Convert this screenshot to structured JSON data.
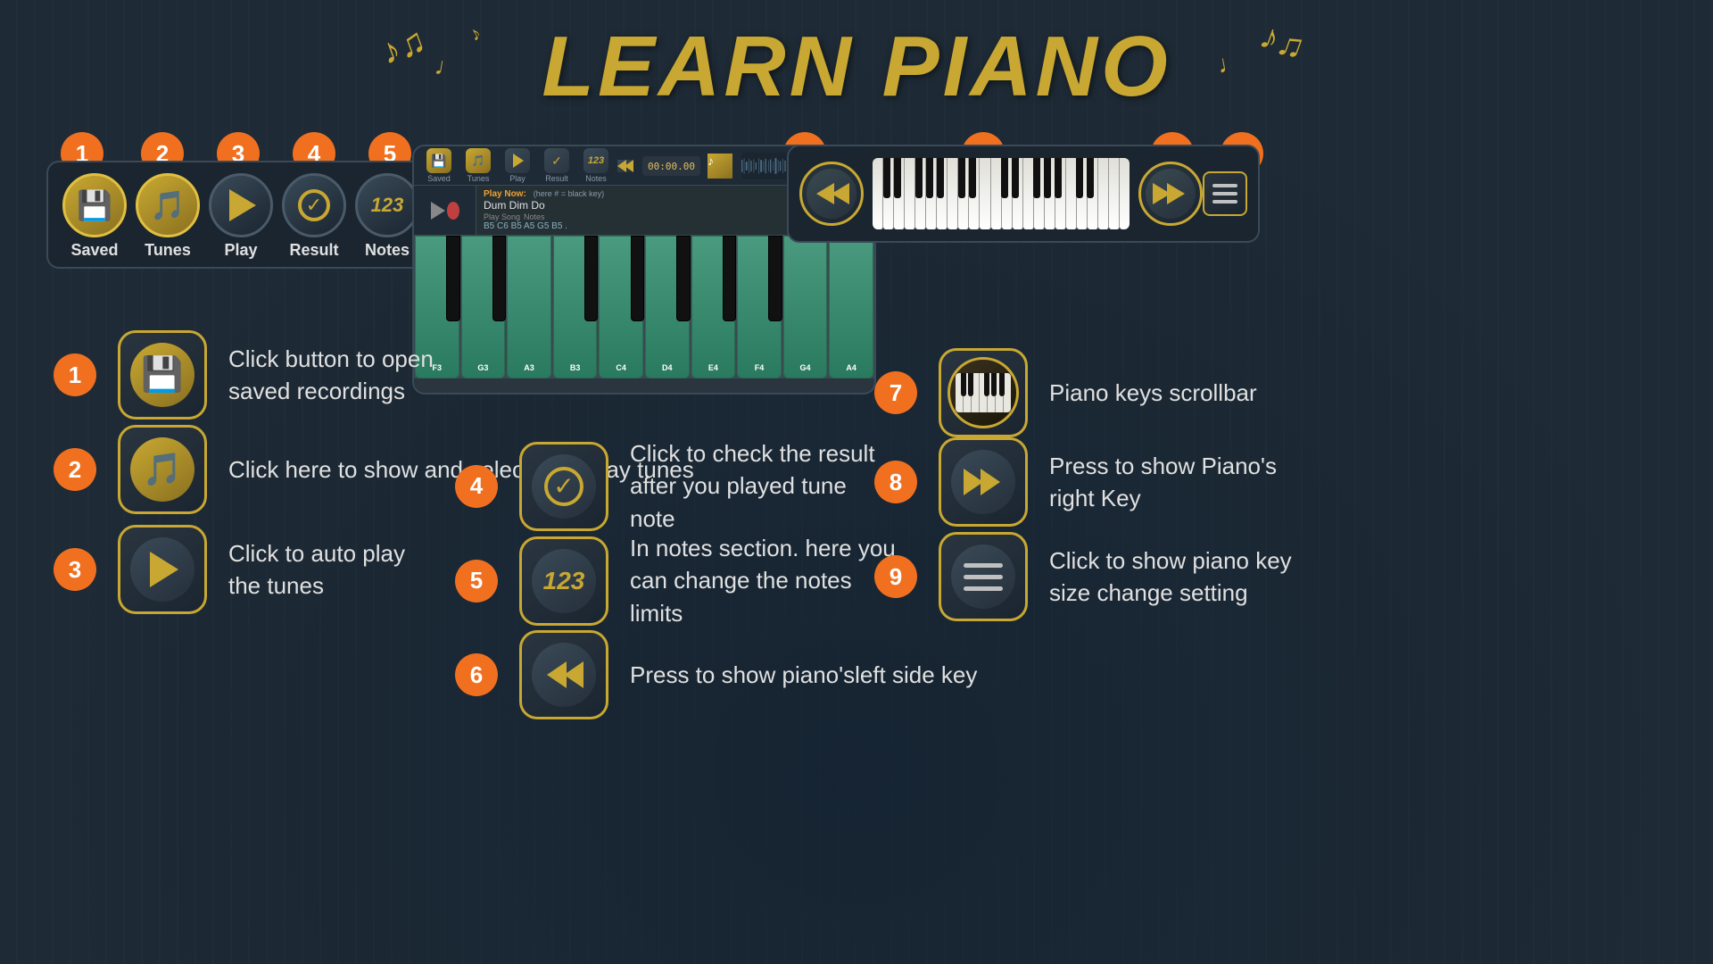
{
  "title": "LEARN PIANO",
  "topButtons": [
    {
      "id": 1,
      "label": "Saved",
      "icon": "saved"
    },
    {
      "id": 2,
      "label": "Tunes",
      "icon": "tunes"
    },
    {
      "id": 3,
      "label": "Play",
      "icon": "play"
    },
    {
      "id": 4,
      "label": "Result",
      "icon": "result"
    },
    {
      "id": 5,
      "label": "Notes",
      "icon": "notes"
    }
  ],
  "helpItems": [
    {
      "id": 1,
      "icon": "saved",
      "text": "Click button to open\nsaved recordings"
    },
    {
      "id": 2,
      "icon": "tunes",
      "text": "Click here to show and select  auto play tunes"
    },
    {
      "id": 3,
      "icon": "play",
      "text": "Click to auto play\nthe tunes"
    },
    {
      "id": 4,
      "icon": "result",
      "text": "Click to check the result\nafter you played tune\nnote"
    },
    {
      "id": 5,
      "icon": "notes",
      "text": "In notes section. here you\n can change the notes\nlimits"
    },
    {
      "id": 6,
      "icon": "rewind",
      "text": "Press to show piano'sleft side key"
    },
    {
      "id": 7,
      "icon": "piano-scroll",
      "text": "Piano keys scrollbar"
    },
    {
      "id": 8,
      "icon": "fastforward",
      "text": "Press to show Piano's\nright Key"
    },
    {
      "id": 9,
      "icon": "menu",
      "text": "Click to show  piano key\nsize change setting"
    }
  ],
  "playNow": {
    "label": "Play Now:",
    "hint": "(here # = black key)",
    "songName": "Dum Dim Do",
    "notes": "B5  C6  B5  A5  G5  B5 ."
  },
  "pianoKeys": [
    "F3",
    "G3",
    "A3",
    "B3",
    "C4",
    "D4",
    "E4",
    "F4",
    "G4",
    "A4"
  ],
  "colors": {
    "orange": "#f07020",
    "gold": "#c8a832",
    "darkBg": "#1e2a35",
    "panelBg": "#1a2530"
  }
}
